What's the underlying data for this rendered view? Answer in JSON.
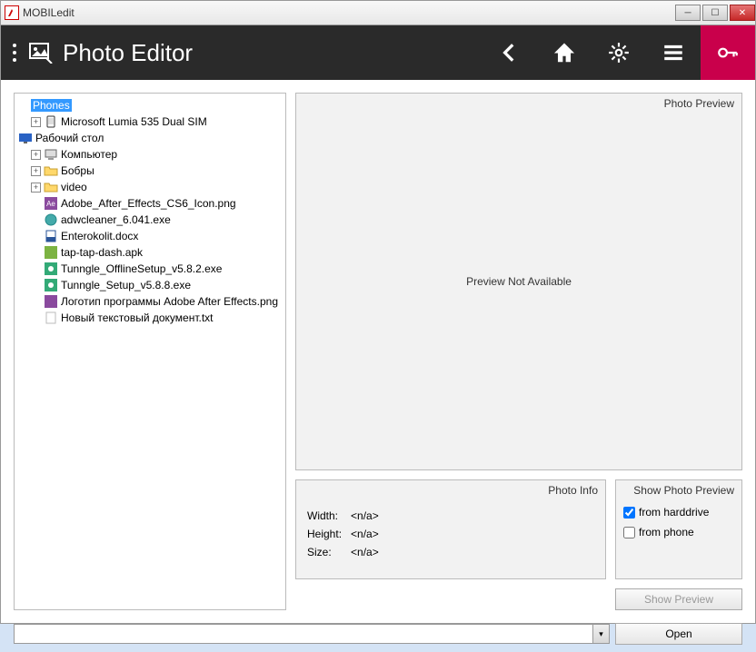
{
  "window": {
    "title": "MOBILedit"
  },
  "header": {
    "title": "Photo Editor"
  },
  "tree": {
    "root1": {
      "label": "Phones",
      "selected": true
    },
    "root1_child": "Microsoft Lumia 535 Dual SIM",
    "root2": "Рабочий стол",
    "folders": [
      "Компьютер",
      "Бобры",
      "video"
    ],
    "files": [
      "Adobe_After_Effects_CS6_Icon.png",
      "adwcleaner_6.041.exe",
      "Enterokolit.docx",
      "tap-tap-dash.apk",
      "Tunngle_OfflineSetup_v5.8.2.exe",
      "Tunngle_Setup_v5.8.8.exe",
      "Логотип программы Adobe After Effects.png",
      "Новый текстовый документ.txt"
    ]
  },
  "preview": {
    "title": "Photo Preview",
    "message": "Preview Not Available"
  },
  "info": {
    "title": "Photo Info",
    "width_label": "Width:",
    "width_value": "<n/a>",
    "height_label": "Height:",
    "height_value": "<n/a>",
    "size_label": "Size:",
    "size_value": "<n/a>"
  },
  "show_preview": {
    "title": "Show Photo Preview",
    "from_hd": "from harddrive",
    "from_phone": "from phone"
  },
  "buttons": {
    "show_preview": "Show Preview",
    "open": "Open"
  }
}
